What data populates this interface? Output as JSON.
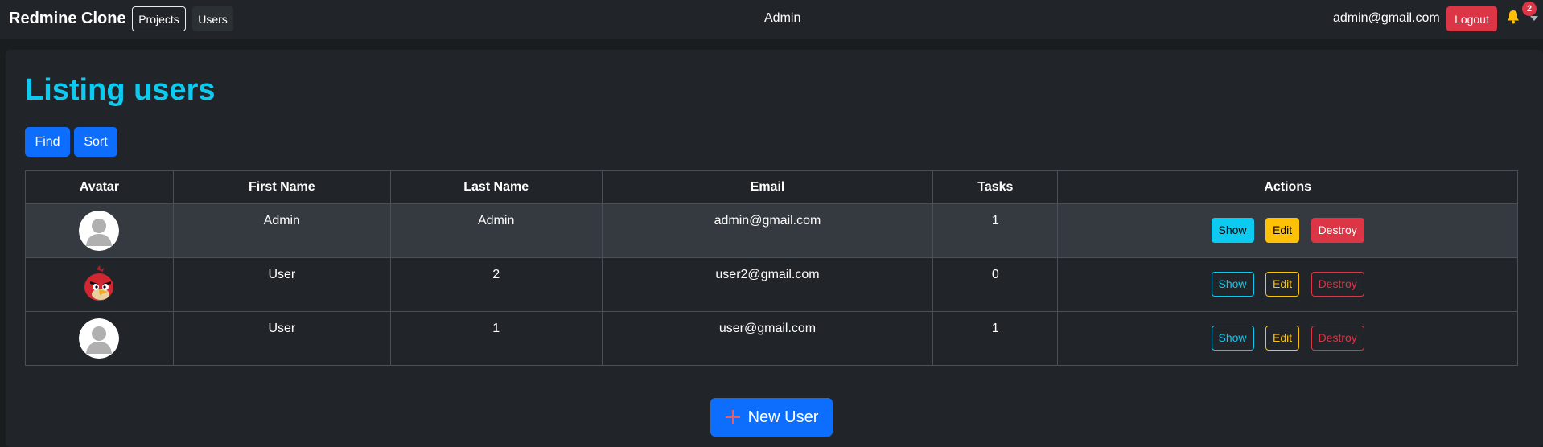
{
  "navbar": {
    "brand": "Redmine Clone",
    "projects_label": "Projects",
    "users_label": "Users",
    "center_label": "Admin",
    "user_email": "admin@gmail.com",
    "logout_label": "Logout",
    "notification_count": "2"
  },
  "page": {
    "title": "Listing users",
    "find_label": "Find",
    "sort_label": "Sort",
    "new_user_label": "New User"
  },
  "table": {
    "headers": [
      "Avatar",
      "First Name",
      "Last Name",
      "Email",
      "Tasks",
      "Actions"
    ],
    "rows": [
      {
        "avatar": "default-avatar",
        "first_name": "Admin",
        "last_name": "Admin",
        "email": "admin@gmail.com",
        "tasks": "1"
      },
      {
        "avatar": "angry-bird-avatar",
        "first_name": "User",
        "last_name": "2",
        "email": "user2@gmail.com",
        "tasks": "0"
      },
      {
        "avatar": "default-avatar",
        "first_name": "User",
        "last_name": "1",
        "email": "user@gmail.com",
        "tasks": "1"
      }
    ],
    "actions": {
      "show": "Show",
      "edit": "Edit",
      "destroy": "Destroy"
    }
  },
  "colors": {
    "accent_title": "#0dcaf0",
    "primary": "#0d6efd",
    "danger": "#dc3545",
    "warning": "#ffc107",
    "info": "#0dcaf0"
  }
}
